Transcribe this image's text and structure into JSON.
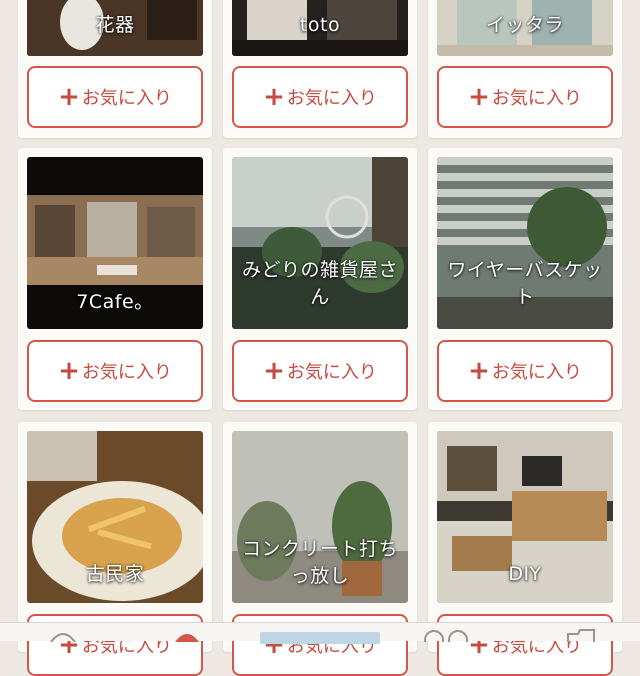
{
  "favorite_label": "お気に入り",
  "accent_color": "#d2574a",
  "cards": [
    {
      "caption": "花器"
    },
    {
      "caption": "toto"
    },
    {
      "caption": "イッタラ"
    },
    {
      "caption": "7Cafe。"
    },
    {
      "caption": "みどりの雑貨屋さん"
    },
    {
      "caption": "ワイヤーバスケット"
    },
    {
      "caption": "古民家"
    },
    {
      "caption": "コンクリート打ち っ放し"
    },
    {
      "caption": "DIY"
    }
  ],
  "tabbar": {
    "tabs": [
      {
        "icon": "home-icon"
      },
      {
        "icon": "notification-icon"
      },
      {
        "icon": "camera-icon"
      },
      {
        "icon": "people-icon"
      },
      {
        "icon": "folder-icon"
      }
    ]
  }
}
